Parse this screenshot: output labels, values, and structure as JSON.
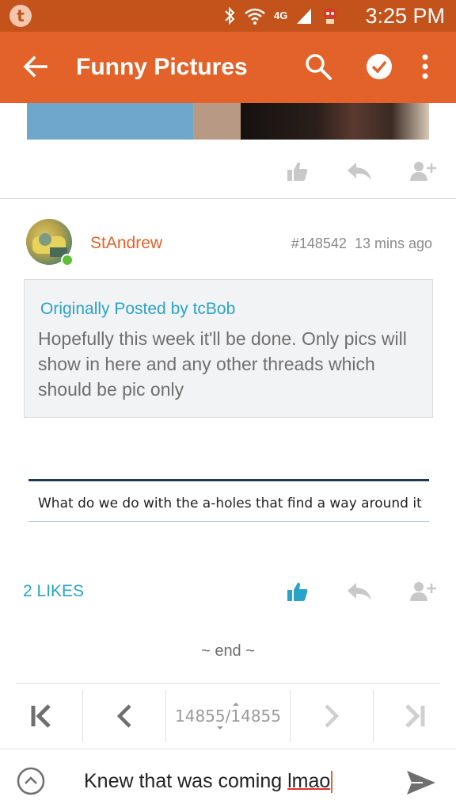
{
  "status_bar": {
    "app_badge": "t",
    "network": "4G",
    "time": "3:25 PM",
    "icons": [
      "bluetooth-icon",
      "wifi-icon",
      "signal-icon",
      "notification-icon"
    ]
  },
  "app_bar": {
    "title": "Funny Pictures",
    "icons": [
      "back-arrow-icon",
      "search-icon",
      "check-circle-icon",
      "more-vert-icon"
    ]
  },
  "post": {
    "username": "StAndrew",
    "post_number": "#148542",
    "time_ago": "13 mins ago",
    "quote": {
      "by": "Originally Posted by tcBob",
      "text": "Hopefully this week it'll be done. Only pics will show in here and any other threads which should be pic only"
    },
    "embedded_text": "What do we do with the a-holes that find a way around it",
    "likes": "2 LIKES"
  },
  "end_marker": "~ end ~",
  "pager": {
    "current": "14855",
    "separator": "/",
    "total": "14855"
  },
  "compose": {
    "text_main": "Knew that was coming ",
    "text_typo": "lmao"
  },
  "colors": {
    "status_bar": "#c3521b",
    "app_bar": "#e2622a",
    "accent_blue": "#2aa3c9",
    "username": "#e2622a",
    "online": "#5fbf3a"
  }
}
